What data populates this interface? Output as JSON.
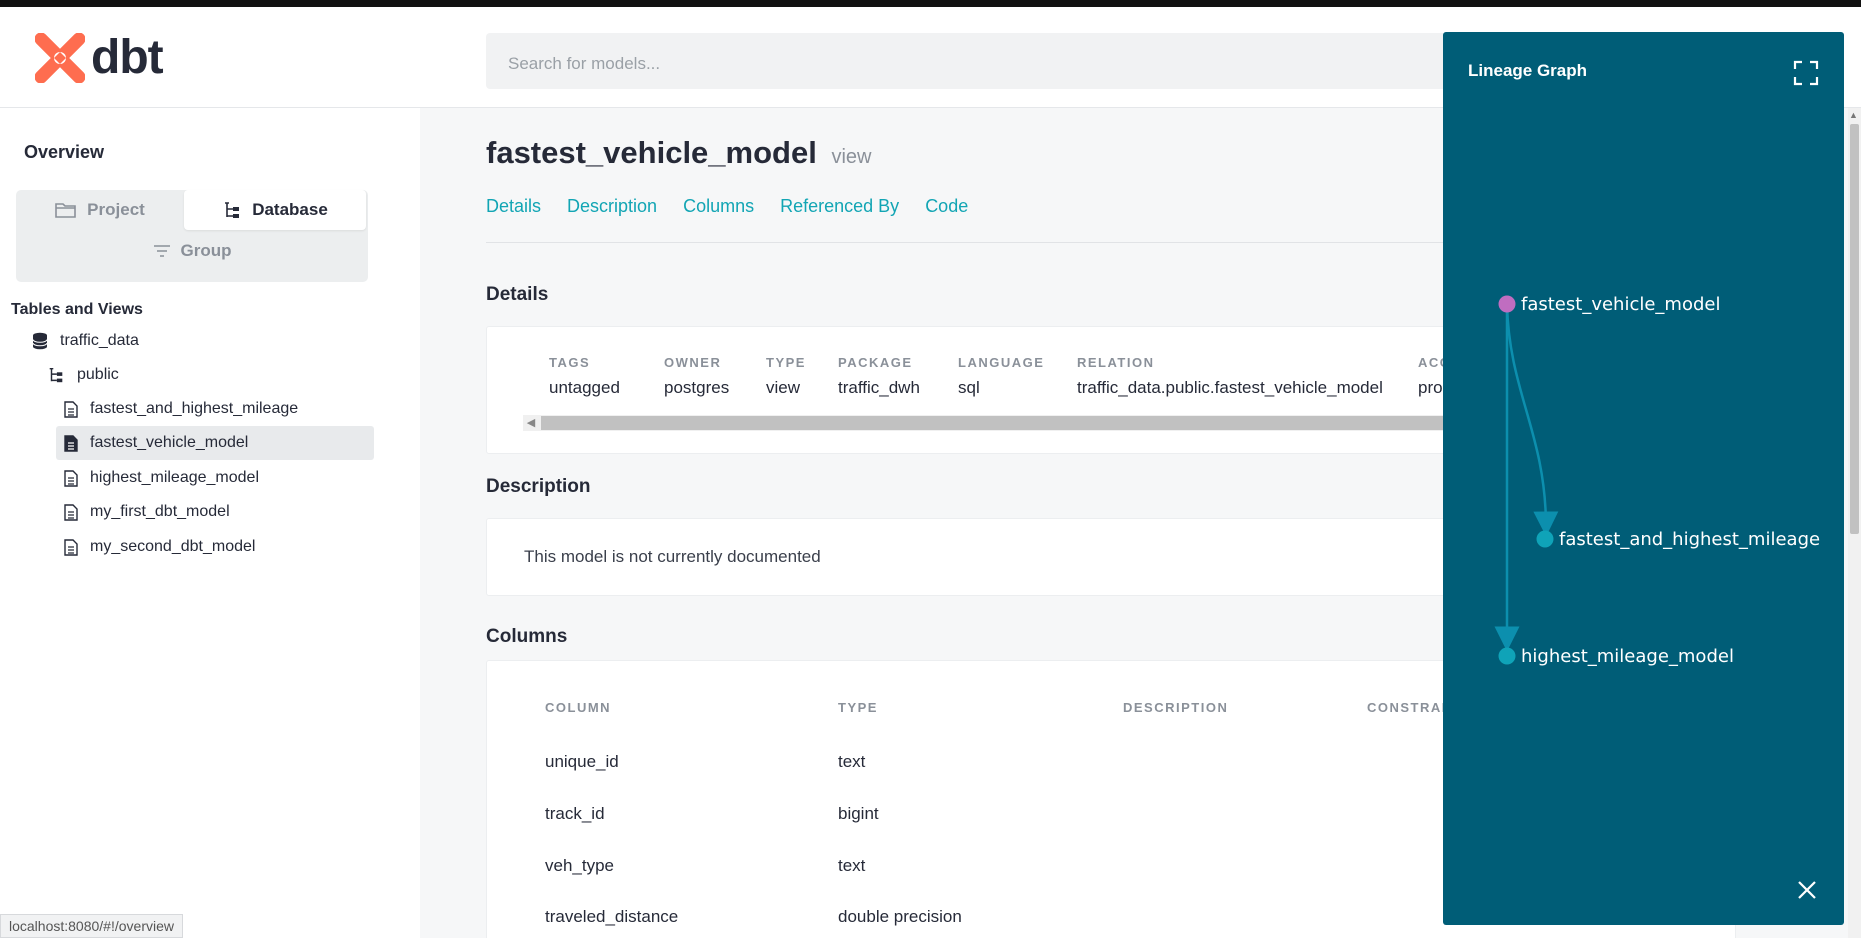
{
  "app": {
    "logo_text": "dbt",
    "search_placeholder": "Search for models...",
    "status_url": "localhost:8080/#!/overview"
  },
  "sidebar": {
    "overview": "Overview",
    "switcher": {
      "project": "Project",
      "database": "Database",
      "group": "Group",
      "selected": "Database"
    },
    "tables_heading": "Tables and Views",
    "database": "traffic_data",
    "schema": "public",
    "models": [
      {
        "label": "fastest_and_highest_mileage",
        "active": false
      },
      {
        "label": "fastest_vehicle_model",
        "active": true
      },
      {
        "label": "highest_mileage_model",
        "active": false
      },
      {
        "label": "my_first_dbt_model",
        "active": false
      },
      {
        "label": "my_second_dbt_model",
        "active": false
      }
    ]
  },
  "main": {
    "title": "fastest_vehicle_model",
    "kind": "view",
    "tabs": [
      "Details",
      "Description",
      "Columns",
      "Referenced By",
      "Code"
    ],
    "details": {
      "heading": "Details",
      "fields": [
        {
          "label": "TAGS",
          "value": "untagged"
        },
        {
          "label": "OWNER",
          "value": "postgres"
        },
        {
          "label": "TYPE",
          "value": "view"
        },
        {
          "label": "PACKAGE",
          "value": "traffic_dwh"
        },
        {
          "label": "LANGUAGE",
          "value": "sql"
        },
        {
          "label": "RELATION",
          "value": "traffic_data.public.fastest_vehicle_model"
        },
        {
          "label": "ACC",
          "value": "pro"
        }
      ]
    },
    "description": {
      "heading": "Description",
      "text": "This model is not currently documented"
    },
    "columns": {
      "heading": "Columns",
      "headers": [
        "COLUMN",
        "TYPE",
        "DESCRIPTION",
        "CONSTRAI"
      ],
      "rows": [
        {
          "column": "unique_id",
          "type": "text"
        },
        {
          "column": "track_id",
          "type": "bigint"
        },
        {
          "column": "veh_type",
          "type": "text"
        },
        {
          "column": "traveled_distance",
          "type": "double precision"
        }
      ]
    }
  },
  "lineage": {
    "title": "Lineage Graph",
    "colors": {
      "panel": "#005d77",
      "selected_node": "#c06dc0",
      "node": "#0fa3b8",
      "edge": "#0c8fae"
    },
    "nodes": [
      {
        "label": "fastest_vehicle_model",
        "selected": true
      },
      {
        "label": "fastest_and_highest_mileage",
        "selected": false
      },
      {
        "label": "highest_mileage_model",
        "selected": false
      }
    ],
    "edges": [
      {
        "from": "fastest_vehicle_model",
        "to": "fastest_and_highest_mileage"
      },
      {
        "from": "fastest_vehicle_model",
        "to": "highest_mileage_model"
      }
    ]
  }
}
